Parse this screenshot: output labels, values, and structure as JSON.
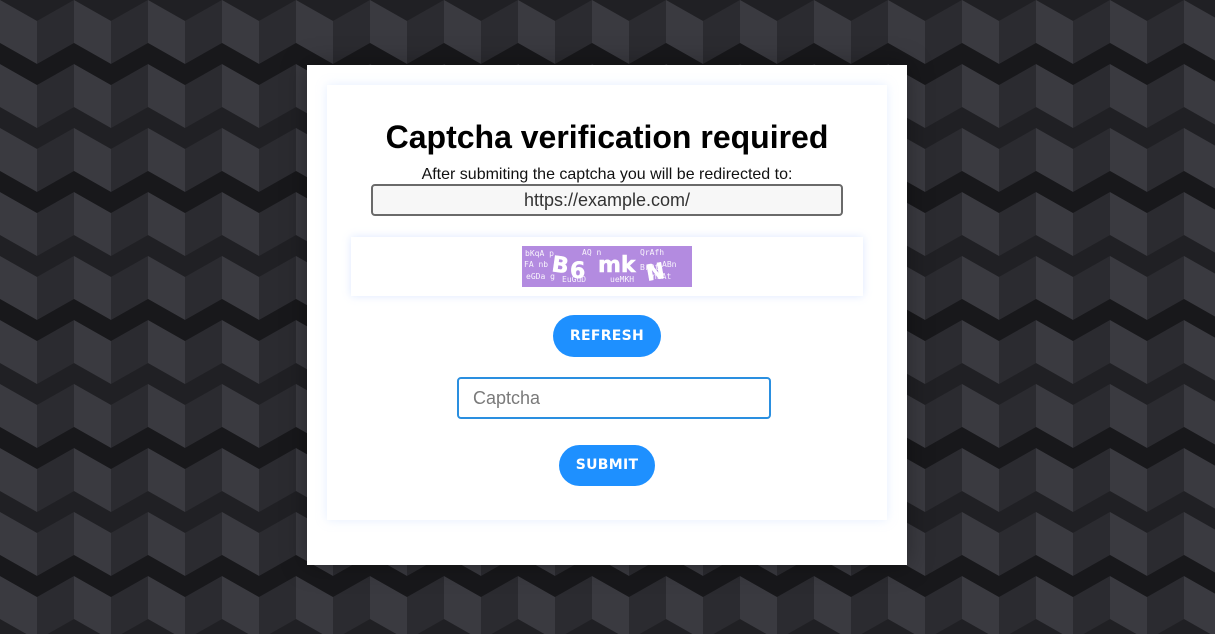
{
  "page": {
    "title": "Captcha verification required",
    "redirect_label": "After submiting the captcha you will be redirected to:",
    "redirect_url": "https://example.com/"
  },
  "captcha": {
    "image_text": "B6mkN",
    "refresh_label": "REFRESH",
    "input_placeholder": "Captcha",
    "input_value": "",
    "submit_label": "SUBMIT"
  },
  "colors": {
    "accent": "#1e90ff",
    "captcha_bg": "#b38be0",
    "background_dark": "#1f1f23"
  }
}
